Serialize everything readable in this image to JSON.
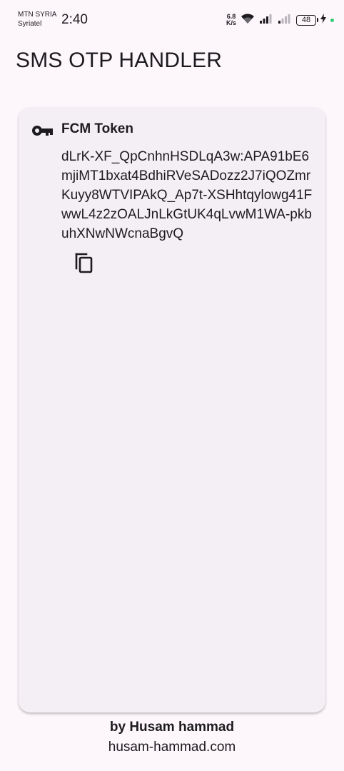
{
  "status_bar": {
    "carrier_primary": "MTN SYRIA",
    "carrier_secondary": "Syriatel",
    "time": "2:40",
    "net_speed_value": "6.8",
    "net_speed_unit": "K/s",
    "battery_level": "48",
    "icons": [
      "wifi-icon",
      "signal-icon",
      "signal-icon",
      "battery-icon",
      "charging-icon",
      "notification-dot"
    ]
  },
  "app_bar": {
    "title": "SMS OTP HANDLER"
  },
  "token_card": {
    "icon": "key-icon",
    "title": "FCM Token",
    "value": "dLrK-XF_QpCnhnHSDLqA3w:APA91bE6mjiMT1bxat4BdhiRVeSADozz2J7iQOZmrKuyy8WTVIPAkQ_Ap7t-XSHhtqylowg41FwwL4z2zOALJnLkGtUK4qLvwM1WA-pkbuhXNwNWcnaBgvQ",
    "copy_icon": "copy-icon"
  },
  "footer": {
    "author": "by Husam hammad",
    "link": "husam-hammad.com"
  },
  "colors": {
    "background": "#fdf7fb",
    "card": "#f3eff4",
    "text": "#1d1b20",
    "charging_dot": "#2ecc71"
  }
}
